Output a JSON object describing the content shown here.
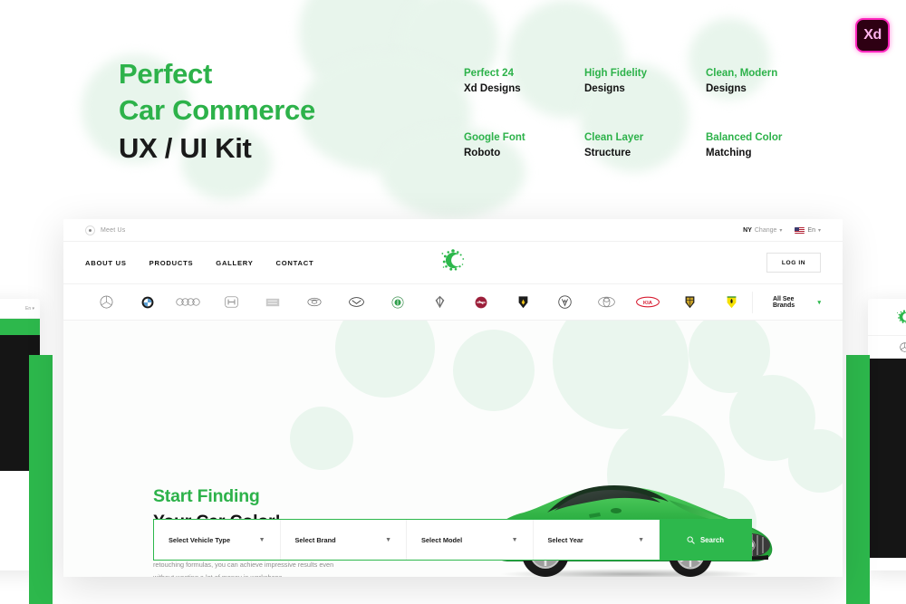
{
  "badge": {
    "label": "Xd"
  },
  "headline": {
    "line1": "Perfect",
    "line2": "Car Commerce",
    "line3": "UX / UI Kit"
  },
  "features": [
    {
      "top": "Perfect 24",
      "bottom": "Xd Designs"
    },
    {
      "top": "High Fidelity",
      "bottom": "Designs"
    },
    {
      "top": "Clean, Modern",
      "bottom": "Designs"
    },
    {
      "top": "Google Font",
      "bottom": "Roboto"
    },
    {
      "top": "Clean Layer",
      "bottom": "Structure"
    },
    {
      "top": "Balanced Color",
      "bottom": "Matching"
    }
  ],
  "colors": {
    "accent_green": "#2db84c",
    "headline_green": "#2db24a",
    "dark_text": "#111111",
    "muted_text": "#8e8e8e",
    "blob_green": "#e8f5ec"
  },
  "mockup": {
    "utility_bar": {
      "meet_us": "Meet Us",
      "location_code": "NY",
      "location_action": "Change",
      "language": "En"
    },
    "nav": {
      "links": [
        "ABOUT US",
        "PRODUCTS",
        "GALLERY",
        "CONTACT"
      ],
      "login_label": "LOG IN"
    },
    "brands": {
      "logos": [
        "mercedes-benz-logo",
        "bmw-logo",
        "audi-logo",
        "honda-logo",
        "lexus-logo",
        "toyota-alt-logo",
        "mazda-logo",
        "skoda-logo",
        "cadillac-logo",
        "opel-logo",
        "lamborghini-logo",
        "volkswagen-logo",
        "toyota-logo",
        "kia-logo",
        "porsche-logo",
        "ferrari-logo"
      ],
      "all_brands_label": "All See Brands"
    },
    "hero": {
      "title_green": "Start Finding",
      "title_dark": "Your Car Color!",
      "paragraph": "Thanks to our high quality and new generation of professional retouching formulas, you can achieve impressive results even without wasting a lot of money in workshops.",
      "car_image": "green-mercedes-amg-gt-sports-car"
    },
    "search": {
      "fields": [
        {
          "label": "Select Vehicle Type"
        },
        {
          "label": "Select Brand"
        },
        {
          "label": "Select Model"
        },
        {
          "label": "Select Year"
        }
      ],
      "button_label": "Search"
    }
  }
}
